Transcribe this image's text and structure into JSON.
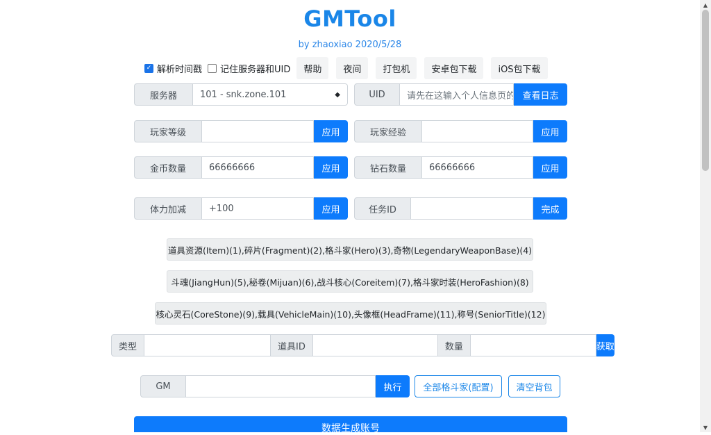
{
  "header": {
    "title": "GMTool",
    "subtitle": "by zhaoxiao 2020/5/28"
  },
  "toolbar": {
    "parse_timestamp": {
      "label": "解析时间戳",
      "checked": true
    },
    "remember_server_uid": {
      "label": "记住服务器和UID",
      "checked": false
    },
    "buttons": [
      "帮助",
      "夜间",
      "打包机",
      "安卓包下载",
      "iOS包下载"
    ]
  },
  "server": {
    "label": "服务器",
    "value": "101 - snk.zone.101"
  },
  "uid": {
    "label": "UID",
    "placeholder": "请先在这输入个人信息页的UID",
    "button": "查看日志"
  },
  "player_level": {
    "label": "玩家等级",
    "value": "",
    "button": "应用"
  },
  "player_exp": {
    "label": "玩家经验",
    "value": "",
    "button": "应用"
  },
  "gold": {
    "label": "金币数量",
    "value": "66666666",
    "button": "应用"
  },
  "diamond": {
    "label": "钻石数量",
    "value": "66666666",
    "button": "应用"
  },
  "stamina": {
    "label": "体力加减",
    "value": "+100",
    "button": "应用"
  },
  "task": {
    "label": "任务ID",
    "value": "",
    "button": "完成"
  },
  "categories": [
    "道具资源(Item)(1),碎片(Fragment)(2),格斗家(Hero)(3),奇物(LegendaryWeaponBase)(4)",
    "斗魂(JiangHun)(5),秘卷(Mijuan)(6),战斗核心(Coreitem)(7),格斗家时装(HeroFashion)(8)",
    "核心灵石(CoreStone)(9),载具(VehicleMain)(10),头像框(HeadFrame)(11),称号(SeniorTitle)(12)"
  ],
  "item_form": {
    "type_label": "类型",
    "item_id_label": "道具ID",
    "quantity_label": "数量",
    "button": "获取"
  },
  "gm": {
    "label": "GM",
    "value": "",
    "execute": "执行",
    "all_heroes": "全部格斗家(配置)",
    "clear_bag": "清空背包"
  },
  "generate_account": "数据生成账号",
  "colors": {
    "primary": "#0d7bfc",
    "title": "#1a86e8",
    "addon_bg": "#e9ecef"
  }
}
